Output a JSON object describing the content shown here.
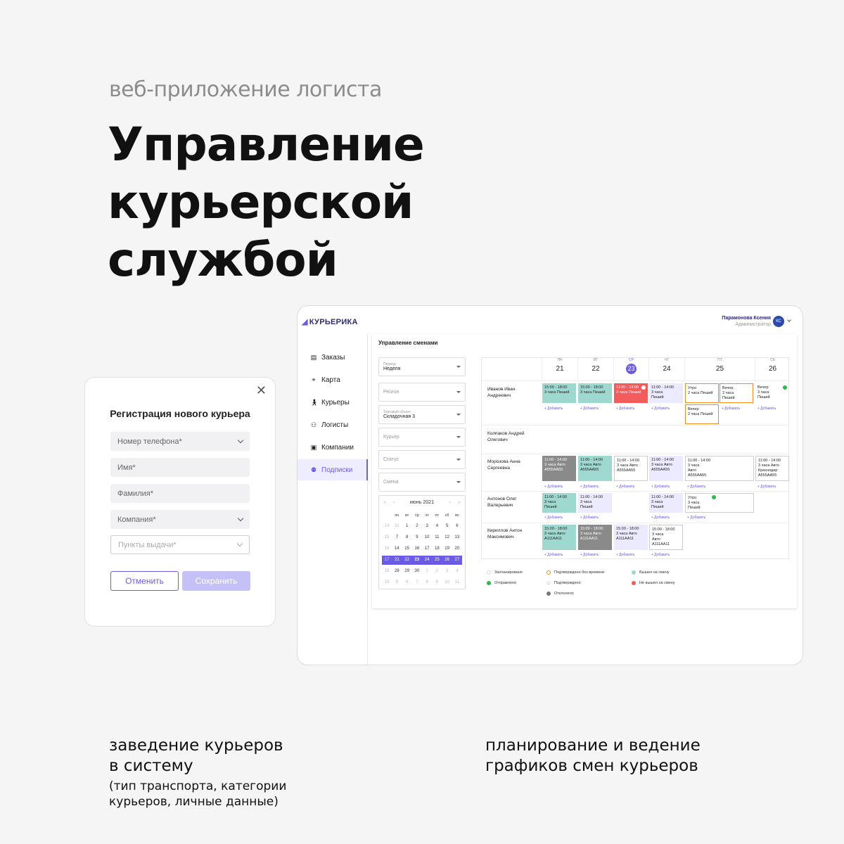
{
  "hero": {
    "subtitle": "веб-приложение логиста",
    "title_line1": "Управление курьерской",
    "title_line2": "службой"
  },
  "captions": {
    "left_line1": "заведение курьеров",
    "left_line2": "в систему",
    "left_sub1": "(тип транспорта, категории",
    "left_sub2": "курьеров, личные данные)",
    "right_line1": "планирование и ведение",
    "right_line2": "графиков смен курьеров"
  },
  "modal": {
    "title": "Регистрация нового курьера",
    "fields": [
      "Номер телефона*",
      "Имя*",
      "Фамилия*",
      "Компания*",
      "Пункты выдачи*"
    ],
    "cancel": "Отменить",
    "save": "Сохранить"
  },
  "app": {
    "logo": "КУРЬЕРИКА",
    "user_name": "Парамонова Ксения",
    "user_role": "Администратор",
    "user_initials": "КС",
    "nav": [
      "Заказы",
      "Карта",
      "Курьеры",
      "Логисты",
      "Компании",
      "Подписки"
    ],
    "page_title": "Управление сменами",
    "filters": {
      "period_label": "Период",
      "period_value": "Неделя",
      "region": "Регион",
      "object_label": "Торговый объект",
      "object_value": "Складочная 3",
      "courier": "Курьер",
      "status": "Статус",
      "shift": "Смена"
    },
    "calendar": {
      "month": "июнь 2021",
      "dow": [
        "пн",
        "вт",
        "ср",
        "чт",
        "пт",
        "сб",
        "вс"
      ],
      "weeks": [
        [
          "31",
          "1",
          "2",
          "3",
          "4",
          "5",
          "6"
        ],
        [
          "7",
          "8",
          "9",
          "10",
          "11",
          "12",
          "13"
        ],
        [
          "14",
          "15",
          "16",
          "17",
          "18",
          "19",
          "20"
        ],
        [
          "21",
          "22",
          "23",
          "24",
          "25",
          "26",
          "27"
        ],
        [
          "28",
          "29",
          "30",
          "1",
          "2",
          "3",
          "4"
        ],
        [
          "5",
          "6",
          "7",
          "8",
          "9",
          "10",
          "11"
        ]
      ],
      "week_numbers": [
        "14",
        "15",
        "16",
        "17",
        "18",
        "19"
      ]
    },
    "days": [
      {
        "dow": "ПН",
        "num": "21"
      },
      {
        "dow": "ВТ",
        "num": "22"
      },
      {
        "dow": "СР",
        "num": "23"
      },
      {
        "dow": "ЧТ",
        "num": "24"
      },
      {
        "dow": "ПТ",
        "num": "25"
      },
      {
        "dow": "СБ",
        "num": "26"
      }
    ],
    "couriers": [
      {
        "l1": "Иванов Иван",
        "l2": "Андреевич"
      },
      {
        "l1": "Колпаков Андрей",
        "l2": "Олегович"
      },
      {
        "l1": "Морозова Анна",
        "l2": "Сергеевна"
      },
      {
        "l1": "Антонов Олег",
        "l2": "Валерьевич"
      },
      {
        "l1": "Кириллов Антон",
        "l2": "Максимович"
      }
    ],
    "add_label": "+ Добавить",
    "shifts": {
      "r1c1": [
        "15:00 - 18:00",
        "3 часа Пеший"
      ],
      "r1c2": [
        "15:00 - 18:00",
        "3 часа Пеший"
      ],
      "r1c3": [
        "11:00 - 14:00",
        "3 часа Пеший"
      ],
      "r1c4": [
        "11:00 - 14:00",
        "3 часа",
        "Пеший"
      ],
      "r1c5a": [
        "Утро",
        "2 часа Пеший"
      ],
      "r1c5b": [
        "Вечер",
        "2 часа",
        "Пеший"
      ],
      "r1c5c": [
        "Вечер",
        "2 часа Пеший"
      ],
      "r1c6": [
        "Вечер",
        "3 часа",
        "Пеший"
      ],
      "r3c1": [
        "11:00 - 14:00",
        "3 часа Авто",
        "А555АА55"
      ],
      "r3c2": [
        "11:00 - 14:00",
        "3 часа Авто",
        "А555АА55"
      ],
      "r3c3": [
        "11:00 - 14:00",
        "3 часа Авто",
        "А555АА55"
      ],
      "r3c4": [
        "11:00 - 14:00",
        "3 часа Авто",
        "А555АА55"
      ],
      "r3c5": [
        "11:00 - 14:00",
        "3 часа",
        "Авто",
        "А555АА55"
      ],
      "r3c6": [
        "11:00 - 14:00",
        "3 часа Авто",
        "Краснодар",
        "А555АА55"
      ],
      "r4c1": [
        "11:00 - 14:00",
        "3 часа",
        "Пеший"
      ],
      "r4c2": [
        "11:00 - 14:00",
        "3 часа",
        "Пеший"
      ],
      "r4c4": [
        "11:00 - 14:00",
        "3 часа",
        "Пеший"
      ],
      "r4c5": [
        "Утро",
        "3 часа",
        "Пеший"
      ],
      "r5c1": [
        "15:00 - 18:00",
        "3 часа Авто",
        "А111АА11"
      ],
      "r5c2": [
        "15:00 - 18:00",
        "3 часа Авто",
        "А111АА11"
      ],
      "r5c3": [
        "15:00 - 18:00",
        "3 часа Авто",
        "А111АА11"
      ],
      "r5c4": [
        "15:00 - 18:00",
        "3 часа",
        "Авто",
        "А111АА11"
      ]
    },
    "legend": {
      "planned": "Запланировано",
      "sent": "Отправлено",
      "confirmed_no_time": "Подтверждено без времени",
      "confirmed": "Подтверждено",
      "rejected": "Отклонено",
      "on_shift": "Вышел на смену",
      "no_show": "Не вышел на смену"
    }
  },
  "colors": {
    "accent": "#6b5ce7",
    "teal": "#9fd8cf",
    "red": "#f25c5c",
    "gray": "#8a8a8a",
    "orange": "#f08c1e",
    "green": "#2fb94a"
  }
}
